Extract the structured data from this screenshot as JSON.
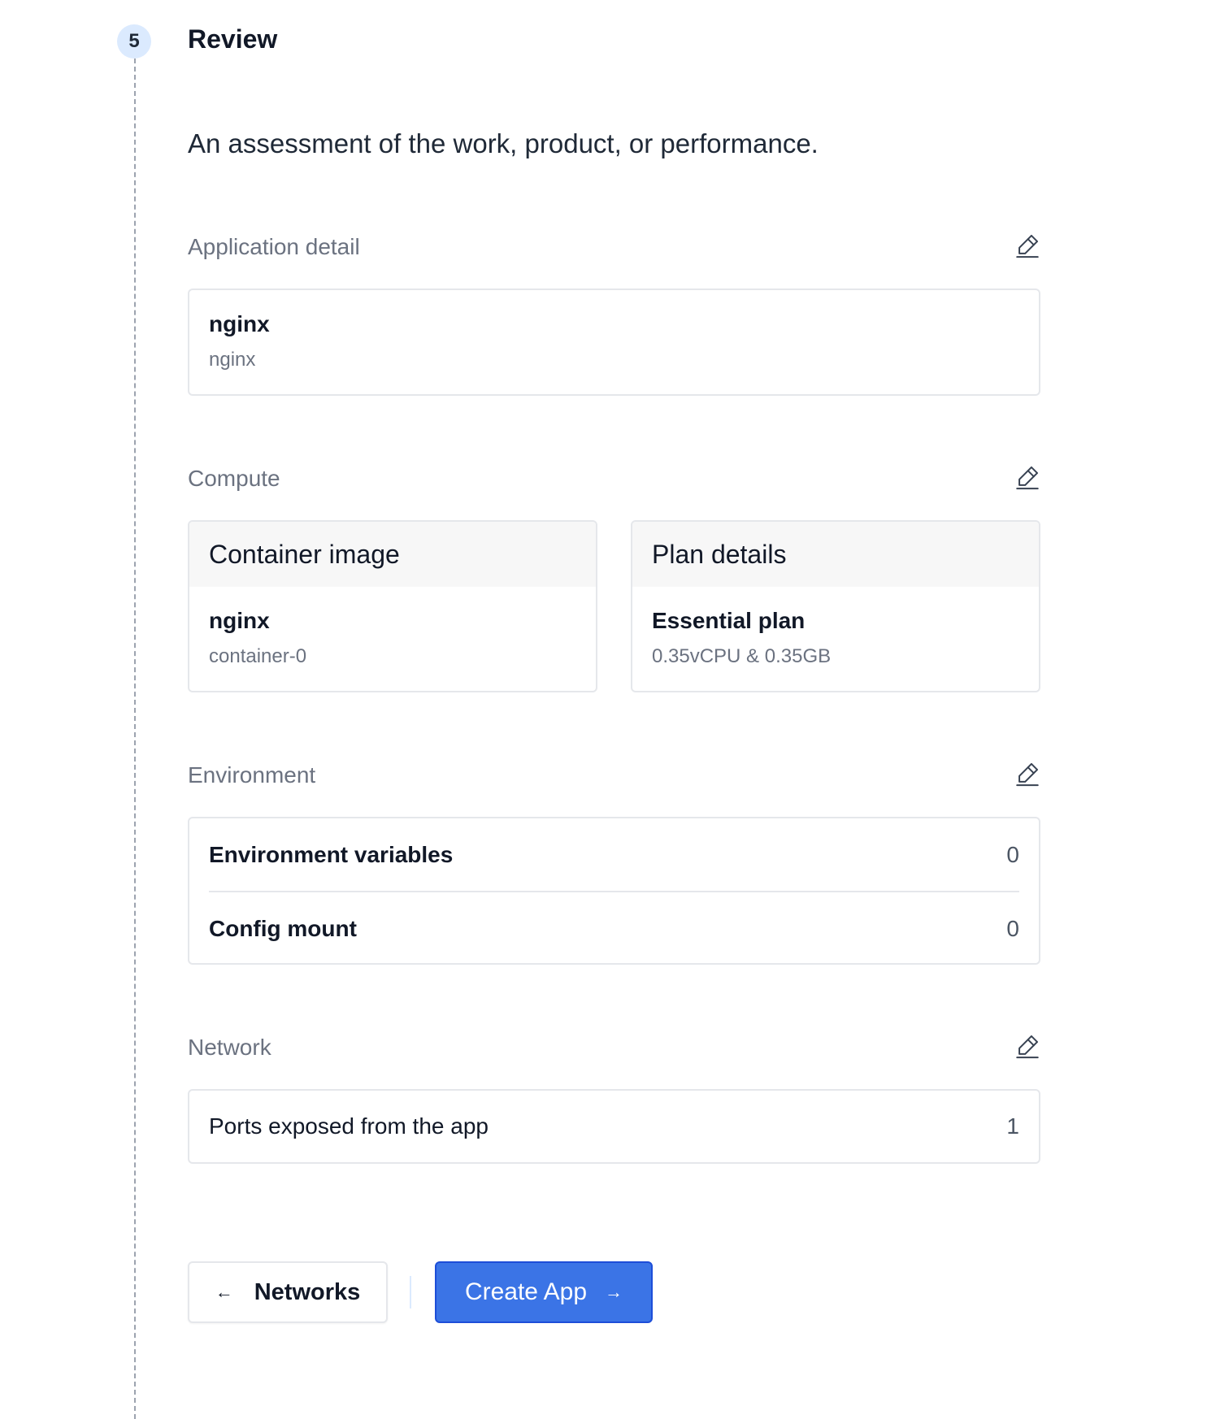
{
  "step": {
    "number": "5",
    "title": "Review",
    "description": "An assessment of the work, product, or performance."
  },
  "application": {
    "section_title": "Application detail",
    "name": "nginx",
    "subtitle": "nginx"
  },
  "compute": {
    "section_title": "Compute",
    "container_image": {
      "header": "Container image",
      "name": "nginx",
      "subtitle": "container-0"
    },
    "plan": {
      "header": "Plan details",
      "name": "Essential plan",
      "subtitle": "0.35vCPU & 0.35GB"
    }
  },
  "environment": {
    "section_title": "Environment",
    "rows": [
      {
        "label": "Environment variables",
        "value": "0"
      },
      {
        "label": "Config mount",
        "value": "0"
      }
    ]
  },
  "network": {
    "section_title": "Network",
    "label": "Ports exposed from the app",
    "value": "1"
  },
  "actions": {
    "back_label": "Networks",
    "back_icon": "arrow-left-icon",
    "create_label": "Create App",
    "create_icon": "arrow-right-icon",
    "primary_color": "#3b74e6"
  }
}
